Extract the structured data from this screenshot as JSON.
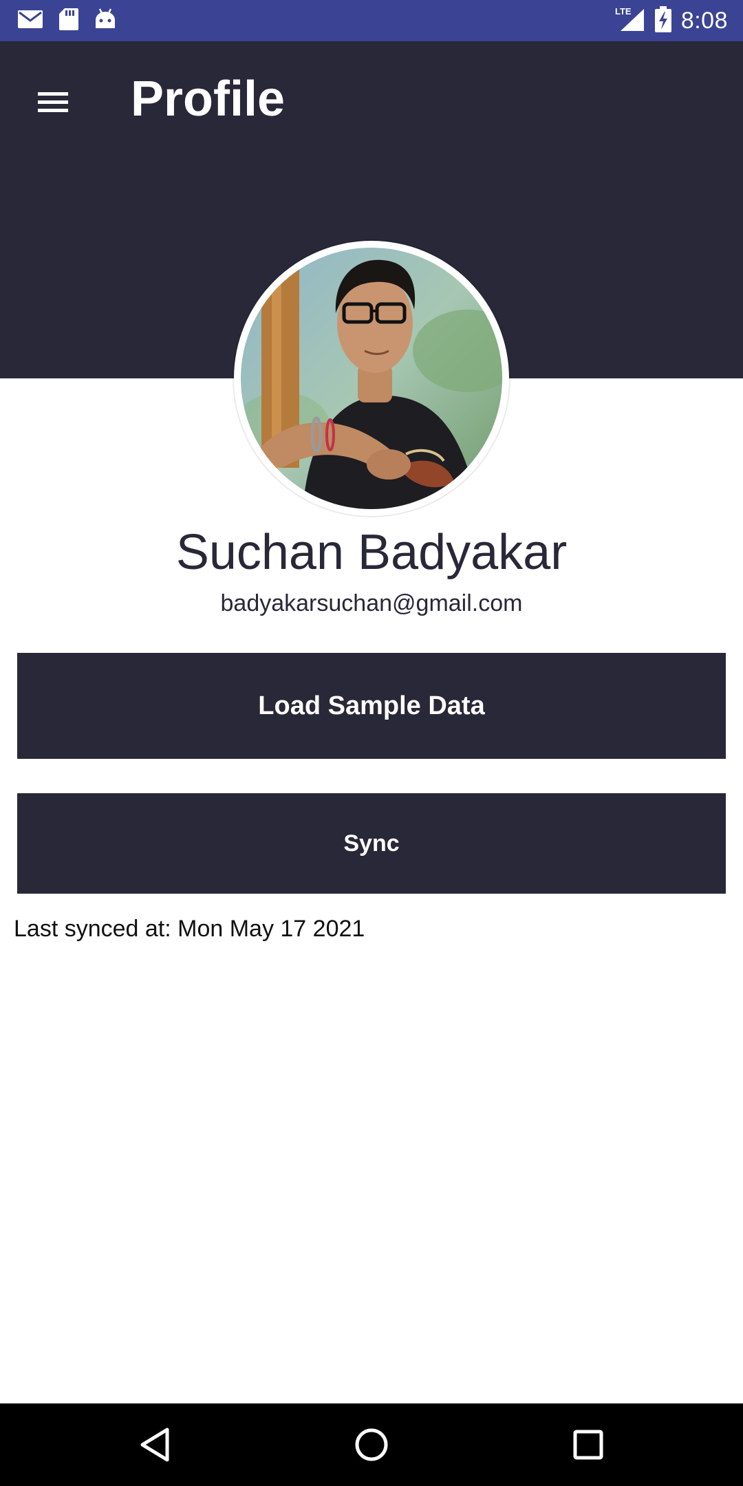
{
  "status_bar": {
    "time": "8:08",
    "network": "LTE",
    "left_icons": [
      "gmail-icon",
      "sd-card-icon",
      "android-icon"
    ],
    "right_icons": [
      "lte-signal-icon",
      "battery-charging-icon"
    ]
  },
  "app_bar": {
    "menu_icon": "hamburger-menu-icon",
    "title": "Profile",
    "background": "#282838"
  },
  "profile": {
    "name": "Suchan Badyakar",
    "email": "badyakarsuchan@gmail.com",
    "avatar_icon": "profile-photo"
  },
  "actions": {
    "load_sample_label": "Load Sample Data",
    "sync_label": "Sync",
    "button_color": "#282838"
  },
  "sync_status": {
    "text": "Last synced at: Mon May 17 2021"
  },
  "nav_bar": {
    "icons": [
      "back-icon",
      "home-icon",
      "recents-icon"
    ]
  },
  "colors": {
    "status_bar": "#3b4394",
    "primary_dark": "#282838",
    "text_dark": "#282838",
    "background": "#ffffff"
  }
}
